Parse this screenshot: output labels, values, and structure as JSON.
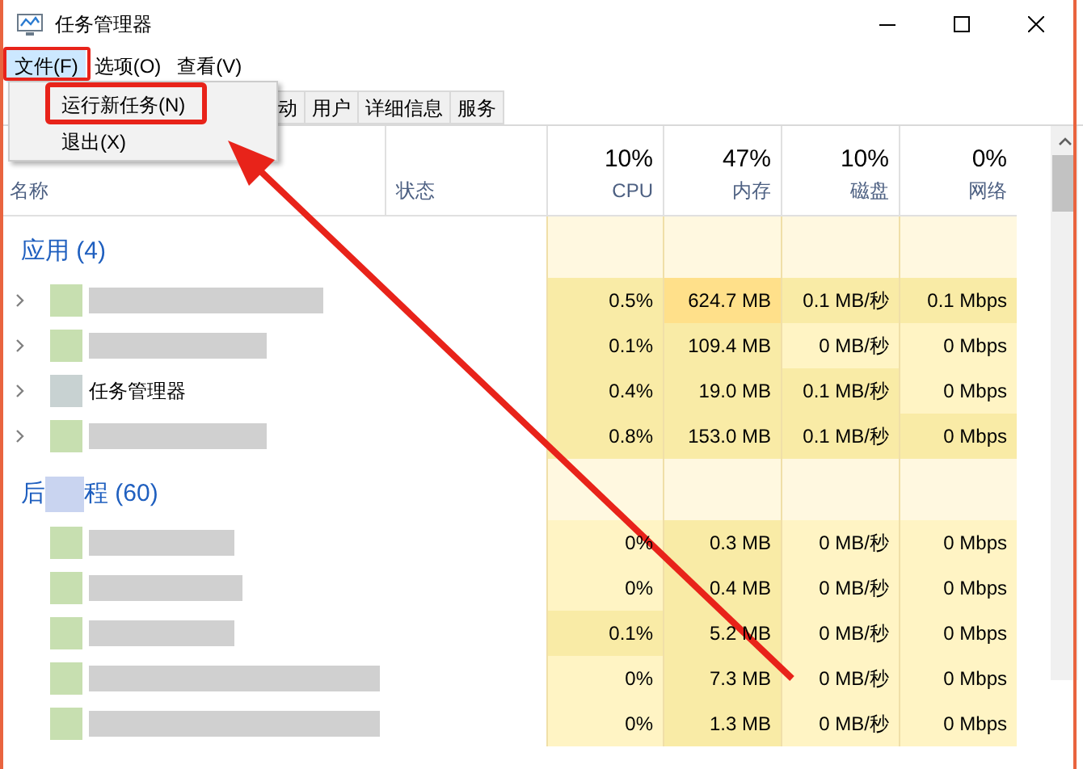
{
  "window": {
    "title": "任务管理器"
  },
  "menus": [
    {
      "label": "文件(F)",
      "selected": true
    },
    {
      "label": "选项(O)",
      "selected": false
    },
    {
      "label": "查看(V)",
      "selected": false
    }
  ],
  "file_menu": {
    "items": [
      {
        "label": "运行新任务(N)",
        "highlighted": true
      },
      {
        "label": "退出(X)",
        "highlighted": false
      }
    ]
  },
  "tabs": [
    {
      "label": "动",
      "selected": false
    },
    {
      "label": "用户",
      "selected": false
    },
    {
      "label": "详细信息",
      "selected": false
    },
    {
      "label": "服务",
      "selected": false
    }
  ],
  "table": {
    "columns": [
      {
        "label": "名称"
      },
      {
        "label": "状态"
      },
      {
        "percent": "10%",
        "label": "CPU"
      },
      {
        "percent": "47%",
        "label": "内存"
      },
      {
        "percent": "10%",
        "label": "磁盘"
      },
      {
        "percent": "0%",
        "label": "网络"
      }
    ],
    "groups": [
      {
        "title": "应用 (4)",
        "rows": [
          {
            "name": null,
            "expandable": true,
            "cells": [
              {
                "text": "0.5%",
                "color": "#f9eba6"
              },
              {
                "text": "624.7 MB",
                "color": "#ffe08a"
              },
              {
                "text": "0.1 MB/秒",
                "color": "#f9eba6"
              },
              {
                "text": "0.1 Mbps",
                "color": "#f9eba6"
              }
            ]
          },
          {
            "name": null,
            "expandable": true,
            "cells": [
              {
                "text": "0.1%",
                "color": "#f9eba6"
              },
              {
                "text": "109.4 MB",
                "color": "#f9eba6"
              },
              {
                "text": "0 MB/秒",
                "color": "#fff4c4"
              },
              {
                "text": "0 Mbps",
                "color": "#fff4c4"
              }
            ]
          },
          {
            "name": "任务管理器",
            "expandable": true,
            "cells": [
              {
                "text": "0.4%",
                "color": "#f9eba6"
              },
              {
                "text": "19.0 MB",
                "color": "#f9eba6"
              },
              {
                "text": "0.1 MB/秒",
                "color": "#f9eba6"
              },
              {
                "text": "0 Mbps",
                "color": "#fff4c4"
              }
            ]
          },
          {
            "name": null,
            "expandable": true,
            "cells": [
              {
                "text": "0.8%",
                "color": "#f9eba6"
              },
              {
                "text": "153.0 MB",
                "color": "#f9eba6"
              },
              {
                "text": "0.1 MB/秒",
                "color": "#f9eba6"
              },
              {
                "text": "0 Mbps",
                "color": "#f9eba6"
              }
            ]
          }
        ]
      },
      {
        "title_parts": [
          "后",
          "程 (60)"
        ],
        "rows": [
          {
            "name": null,
            "expandable": false,
            "cells": [
              {
                "text": "0%",
                "color": "#fff4c4"
              },
              {
                "text": "0.3 MB",
                "color": "#f9eba6"
              },
              {
                "text": "0 MB/秒",
                "color": "#fff4c4"
              },
              {
                "text": "0 Mbps",
                "color": "#fff4c4"
              }
            ]
          },
          {
            "name": null,
            "expandable": false,
            "cells": [
              {
                "text": "0%",
                "color": "#fff4c4"
              },
              {
                "text": "0.4 MB",
                "color": "#f9eba6"
              },
              {
                "text": "0 MB/秒",
                "color": "#fff4c4"
              },
              {
                "text": "0 Mbps",
                "color": "#fff4c4"
              }
            ]
          },
          {
            "name": null,
            "expandable": false,
            "cells": [
              {
                "text": "0.1%",
                "color": "#f9eba6"
              },
              {
                "text": "5.2 MB",
                "color": "#f9eba6"
              },
              {
                "text": "0 MB/秒",
                "color": "#fff4c4"
              },
              {
                "text": "0 Mbps",
                "color": "#fff4c4"
              }
            ]
          },
          {
            "name": null,
            "expandable": false,
            "cells": [
              {
                "text": "0%",
                "color": "#fff4c4"
              },
              {
                "text": "7.3 MB",
                "color": "#f9eba6"
              },
              {
                "text": "0 MB/秒",
                "color": "#fff4c4"
              },
              {
                "text": "0 Mbps",
                "color": "#fff4c4"
              }
            ]
          },
          {
            "name": null,
            "expandable": false,
            "cells": [
              {
                "text": "0%",
                "color": "#fff4c4"
              },
              {
                "text": "1.3 MB",
                "color": "#f9eba6"
              },
              {
                "text": "0 MB/秒",
                "color": "#fff4c4"
              },
              {
                "text": "0 Mbps",
                "color": "#fff4c4"
              }
            ]
          }
        ]
      }
    ]
  }
}
